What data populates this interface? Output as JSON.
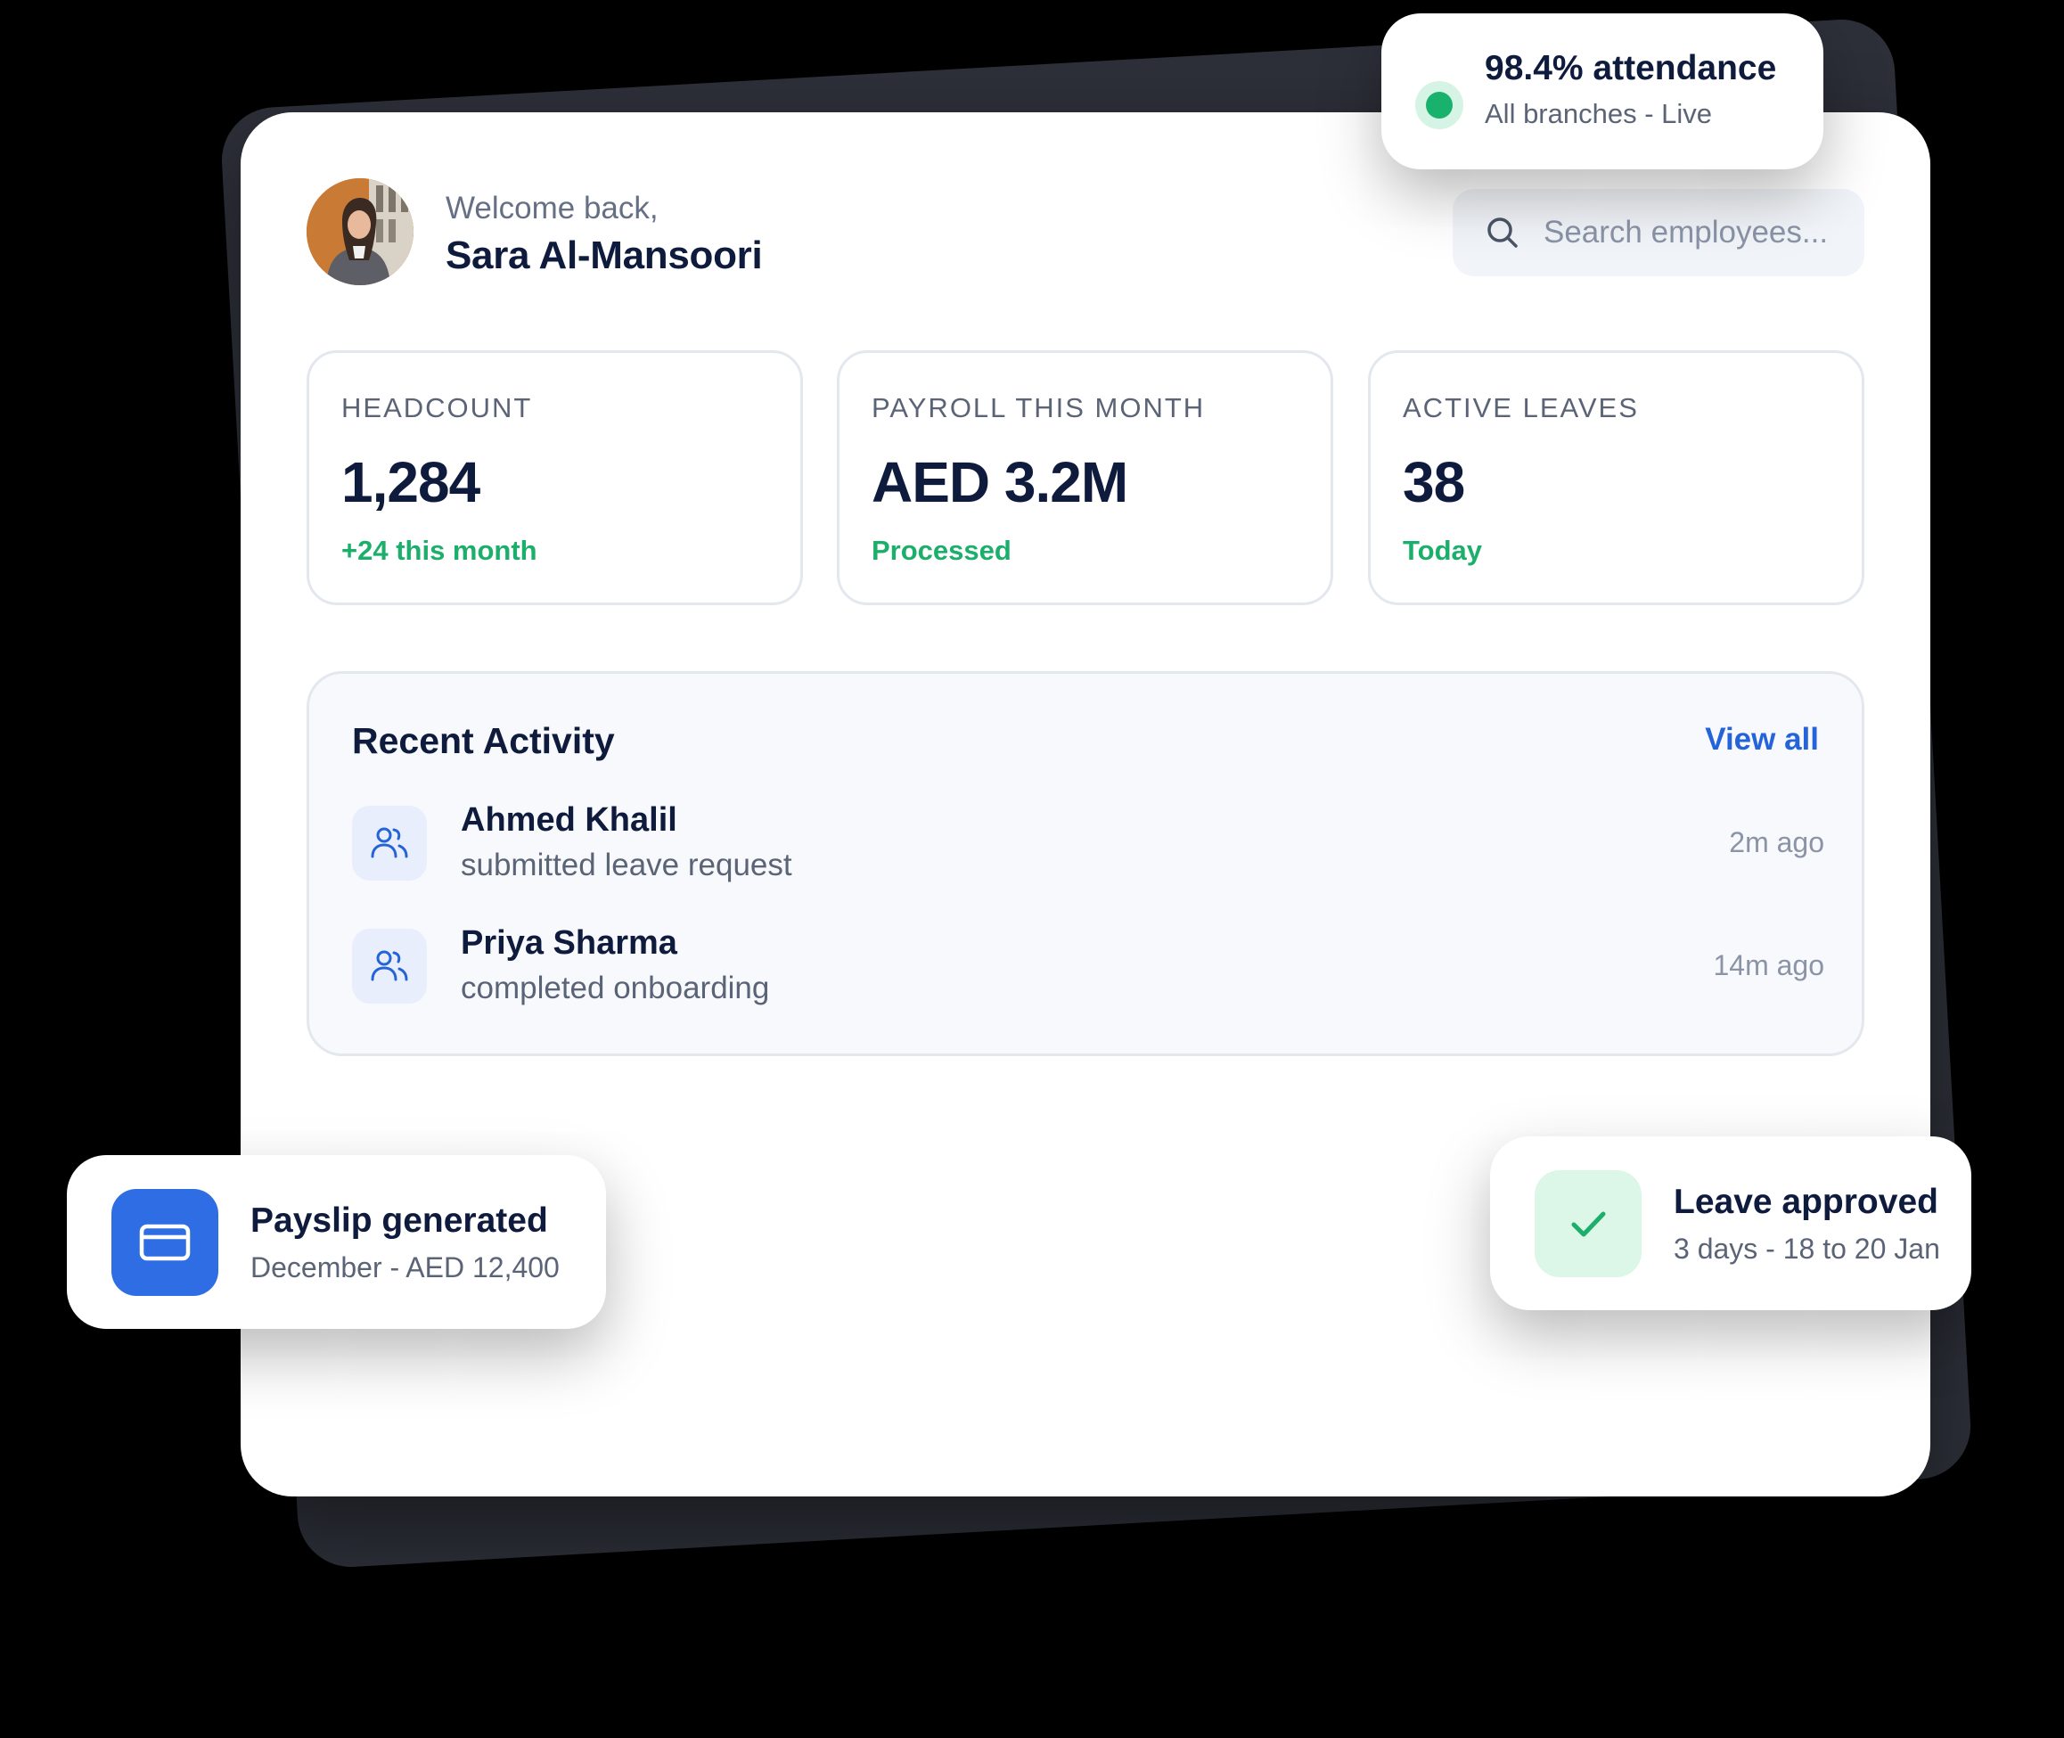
{
  "header": {
    "welcome_text": "Welcome back,",
    "user_name": "Sara Al-Mansoori",
    "search_placeholder": "Search employees..."
  },
  "stats": [
    {
      "label": "HEADCOUNT",
      "value": "1,284",
      "note": "+24 this month"
    },
    {
      "label": "PAYROLL THIS MONTH",
      "value": "AED 3.2M",
      "note": "Processed"
    },
    {
      "label": "ACTIVE LEAVES",
      "value": "38",
      "note": "Today"
    }
  ],
  "activity": {
    "title": "Recent Activity",
    "view_all_label": "View all",
    "items": [
      {
        "name": "Ahmed Khalil",
        "description": "submitted leave request",
        "time": "2m ago",
        "icon": "users-icon"
      },
      {
        "name": "Priya Sharma",
        "description": "completed onboarding",
        "time": "14m ago",
        "icon": "users-icon"
      }
    ]
  },
  "attendance_badge": {
    "title": "98.4% attendance",
    "subtitle": "All branches - Live",
    "status_color": "#18b26d"
  },
  "payslip_toast": {
    "title": "Payslip generated",
    "subtitle": "December - AED 12,400",
    "icon": "credit-card-icon",
    "icon_bg": "#2f6de4"
  },
  "leave_toast": {
    "title": "Leave approved",
    "subtitle": "3 days - 18 to 20 Jan",
    "icon": "check-icon",
    "icon_bg": "#dcf6e7"
  },
  "colors": {
    "accent_blue": "#2563d9",
    "success_green": "#1cae6b",
    "text_dark": "#0f1b3d",
    "backdrop": "#2d3039"
  }
}
